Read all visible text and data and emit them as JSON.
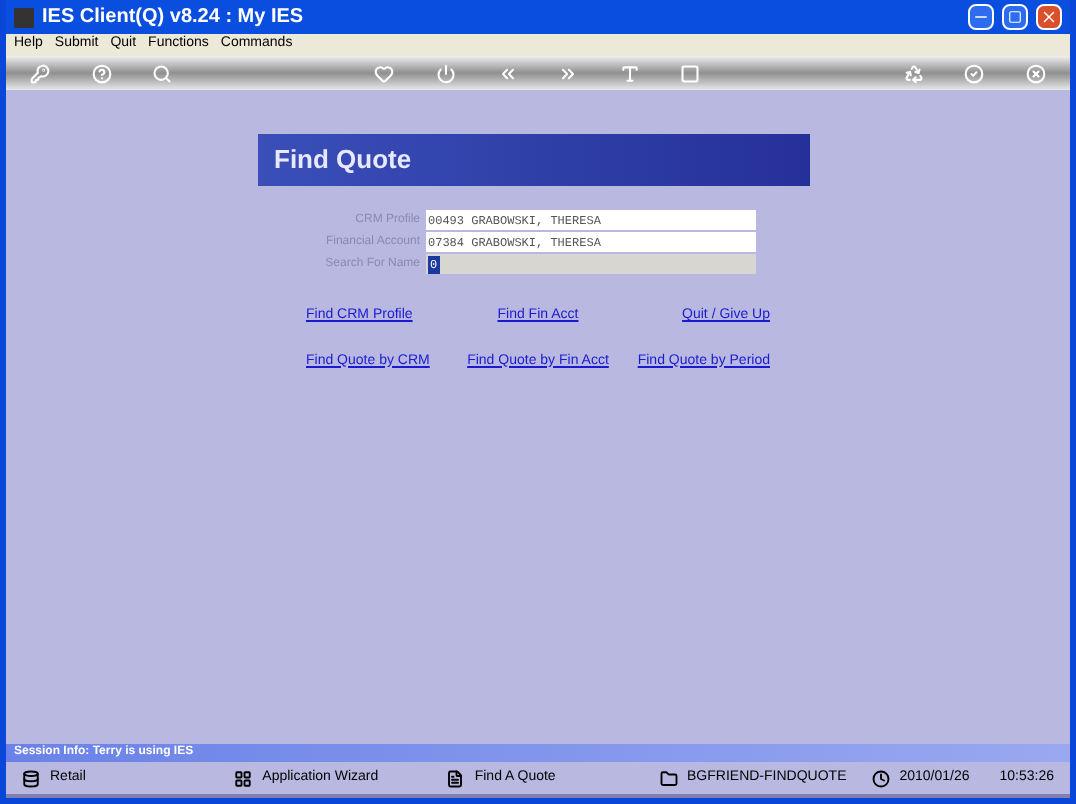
{
  "window": {
    "title": "IES Client(Q) v8.24 : My IES"
  },
  "menu": [
    "Help",
    "Submit",
    "Quit",
    "Functions",
    "Commands"
  ],
  "panel": {
    "title": "Find Quote"
  },
  "fields": [
    {
      "label": "CRM Profile",
      "value": "00493 GRABOWSKI, THERESA",
      "focused": false
    },
    {
      "label": "Financial Account",
      "value": "07384 GRABOWSKI, THERESA",
      "focused": false
    },
    {
      "label": "Search For Name",
      "value": "0",
      "focused": true
    }
  ],
  "links": [
    {
      "label": "Find CRM Profile"
    },
    {
      "label": "Find Fin Acct"
    },
    {
      "label": "Quit / Give Up"
    },
    {
      "label": "Find Quote by CRM"
    },
    {
      "label": "Find Quote by Fin Acct"
    },
    {
      "label": "Find Quote by Period"
    }
  ],
  "session_info": "Session Info: Terry is using IES",
  "status_bar": [
    {
      "kind": "db",
      "text": "Retail"
    },
    {
      "kind": "wizard",
      "text": "Application Wizard"
    },
    {
      "kind": "quote",
      "text": "Find A Quote"
    },
    {
      "kind": "form",
      "text": "BGFRIEND-FINDQUOTE"
    },
    {
      "kind": "clock",
      "text": "2010/01/26",
      "time": "10:53:26"
    }
  ]
}
